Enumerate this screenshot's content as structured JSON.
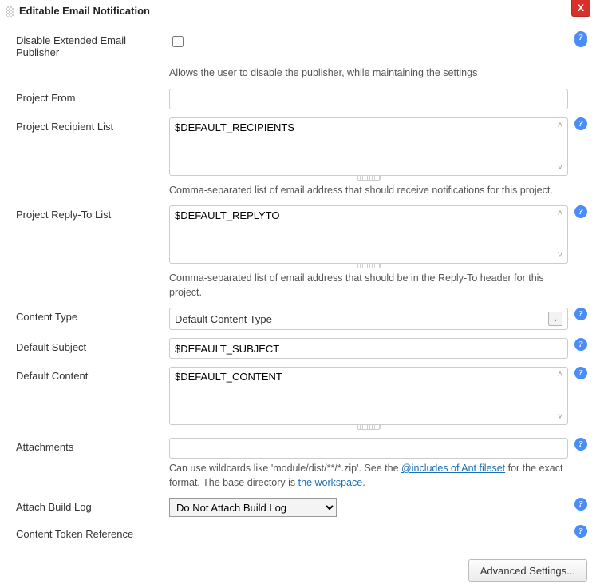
{
  "header": {
    "title": "Editable Email Notification",
    "close": "X"
  },
  "fields": {
    "disable_publisher": {
      "label": "Disable Extended Email Publisher",
      "desc": "Allows the user to disable the publisher, while maintaining the settings"
    },
    "project_from": {
      "label": "Project From",
      "value": ""
    },
    "recipient_list": {
      "label": "Project Recipient List",
      "value": "$DEFAULT_RECIPIENTS",
      "desc": "Comma-separated list of email address that should receive notifications for this project."
    },
    "replyto_list": {
      "label": "Project Reply-To List",
      "value": "$DEFAULT_REPLYTO",
      "desc": "Comma-separated list of email address that should be in the Reply-To header for this project."
    },
    "content_type": {
      "label": "Content Type",
      "selected": "Default Content Type"
    },
    "default_subject": {
      "label": "Default Subject",
      "value": "$DEFAULT_SUBJECT"
    },
    "default_content": {
      "label": "Default Content",
      "value": "$DEFAULT_CONTENT"
    },
    "attachments": {
      "label": "Attachments",
      "value": "",
      "desc_pre": "Can use wildcards like 'module/dist/**/*.zip'. See the ",
      "link1": "@includes of Ant fileset",
      "desc_mid": " for the exact format. The base directory is ",
      "link2": "the workspace",
      "desc_post": "."
    },
    "attach_log": {
      "label": "Attach Build Log",
      "selected": "Do Not Attach Build Log"
    },
    "token_ref": {
      "label": "Content Token Reference"
    }
  },
  "footer": {
    "advanced": "Advanced Settings..."
  },
  "glyphs": {
    "up": "˄",
    "down": "˅",
    "dropdown": "⌄"
  }
}
